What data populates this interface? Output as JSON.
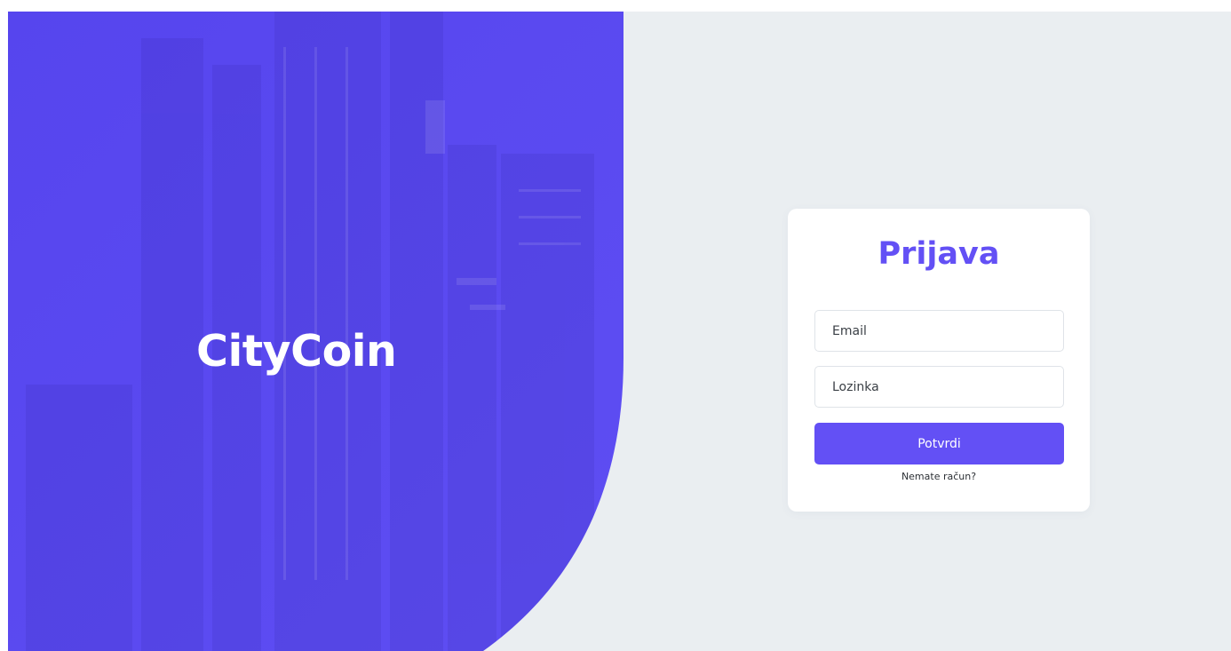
{
  "brand": {
    "name": "CityCoin"
  },
  "login": {
    "title": "Prijava",
    "email_placeholder": "Email",
    "password_placeholder": "Lozinka",
    "submit_label": "Potvrdi",
    "signup_link": "Nemate račun?"
  },
  "colors": {
    "accent": "#6350f5",
    "hero": "#5b4cf2",
    "background": "#eaeef1",
    "card": "#ffffff"
  }
}
